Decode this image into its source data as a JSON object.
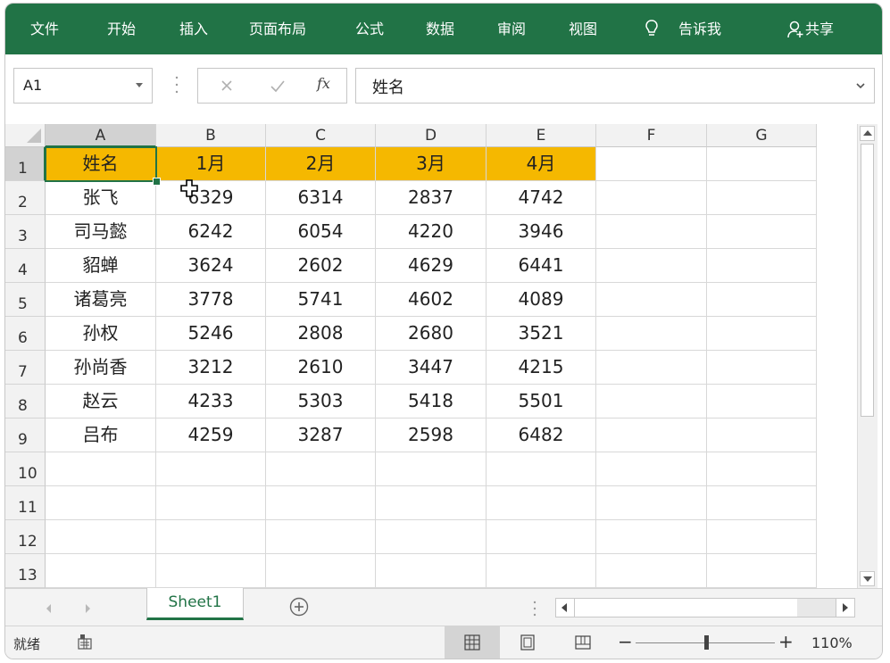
{
  "ribbon": {
    "tabs": [
      "文件",
      "开始",
      "插入",
      "页面布局",
      "公式",
      "数据",
      "审阅",
      "视图"
    ],
    "tell_me": "告诉我",
    "share": "共享",
    "bg_color": "#217346"
  },
  "formula_bar": {
    "name_box": "A1",
    "fx_label": "fx",
    "content": "姓名"
  },
  "grid": {
    "columns": [
      "A",
      "B",
      "C",
      "D",
      "E",
      "F",
      "G"
    ],
    "rows": [
      "1",
      "2",
      "3",
      "4",
      "5",
      "6",
      "7",
      "8",
      "9",
      "10",
      "11",
      "12",
      "13"
    ],
    "header_fill": "#f5b800",
    "selected_cell": "A1",
    "cells": [
      [
        "姓名",
        "1月",
        "2月",
        "3月",
        "4月"
      ],
      [
        "张飞",
        "6329",
        "6314",
        "2837",
        "4742"
      ],
      [
        "司马懿",
        "6242",
        "6054",
        "4220",
        "3946"
      ],
      [
        "貂蝉",
        "3624",
        "2602",
        "4629",
        "6441"
      ],
      [
        "诸葛亮",
        "3778",
        "5741",
        "4602",
        "4089"
      ],
      [
        "孙权",
        "5246",
        "2808",
        "2680",
        "3521"
      ],
      [
        "孙尚香",
        "3212",
        "2610",
        "3447",
        "4215"
      ],
      [
        "赵云",
        "4233",
        "5303",
        "5418",
        "5501"
      ],
      [
        "吕布",
        "4259",
        "3287",
        "2598",
        "6482"
      ]
    ]
  },
  "sheets": {
    "tabs": [
      "Sheet1"
    ],
    "active": "Sheet1"
  },
  "status": {
    "ready": "就绪",
    "zoom": "110%",
    "zoom_minus": "−",
    "zoom_plus": "+"
  }
}
